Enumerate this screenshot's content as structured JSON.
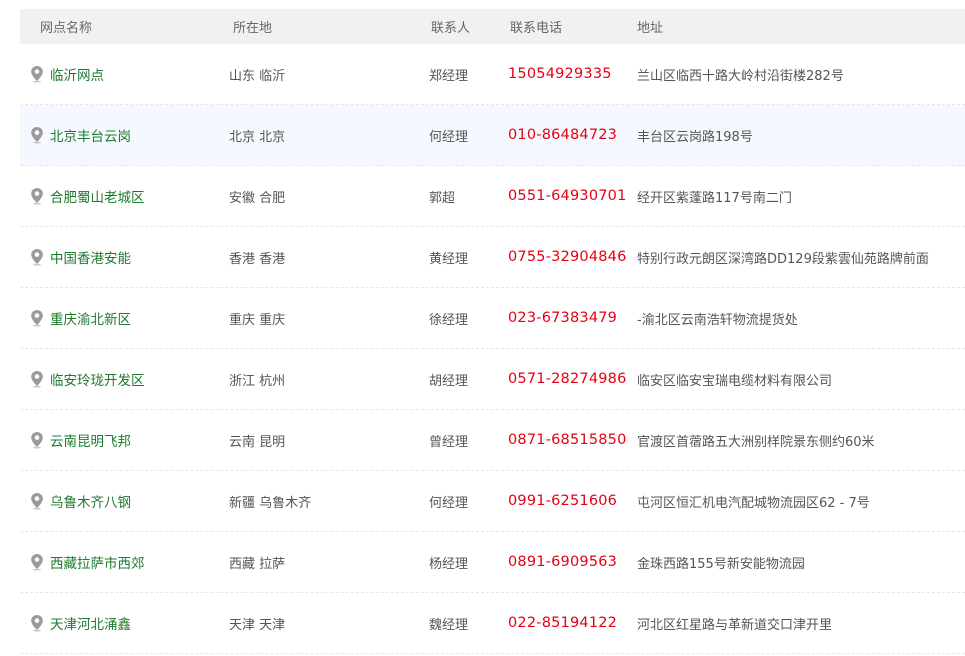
{
  "headers": {
    "name": "网点名称",
    "location": "所在地",
    "contact": "联系人",
    "phone": "联系电话",
    "address": "地址"
  },
  "rows": [
    {
      "name": "临沂网点",
      "location": "山东 临沂",
      "contact": "郑经理",
      "phone": "15054929335",
      "address": "兰山区临西十路大岭村沿街楼282号"
    },
    {
      "name": "北京丰台云岗",
      "location": "北京 北京",
      "contact": "何经理",
      "phone": "010-86484723",
      "address": "丰台区云岗路198号"
    },
    {
      "name": "合肥蜀山老城区",
      "location": "安徽 合肥",
      "contact": "郭超",
      "phone": "0551-64930701",
      "address": "经开区紫蓬路117号南二门"
    },
    {
      "name": "中国香港安能",
      "location": "香港 香港",
      "contact": "黄经理",
      "phone": "0755-32904846",
      "address": "特别行政元朗区深湾路DD129段紫雲仙苑路牌前面"
    },
    {
      "name": "重庆渝北新区",
      "location": "重庆 重庆",
      "contact": "徐经理",
      "phone": "023-67383479",
      "address": "-渝北区云南浩轩物流提货处"
    },
    {
      "name": "临安玲珑开发区",
      "location": "浙江 杭州",
      "contact": "胡经理",
      "phone": "0571-28274986",
      "address": "临安区临安宝瑞电缆材料有限公司"
    },
    {
      "name": "云南昆明飞邦",
      "location": "云南 昆明",
      "contact": "曾经理",
      "phone": "0871-68515850",
      "address": "官渡区首蓿路五大洲别样院景东侧约60米"
    },
    {
      "name": "乌鲁木齐八钢",
      "location": "新疆 乌鲁木齐",
      "contact": "何经理",
      "phone": "0991-6251606",
      "address": "屯河区恒汇机电汽配城物流园区62 - 7号"
    },
    {
      "name": "西藏拉萨市西郊",
      "location": "西藏 拉萨",
      "contact": "杨经理",
      "phone": "0891-6909563",
      "address": "金珠西路155号新安能物流园"
    },
    {
      "name": "天津河北涌鑫",
      "location": "天津 天津",
      "contact": "魏经理",
      "phone": "022-85194122",
      "address": "河北区红星路与革新道交口津开里"
    }
  ],
  "colors": {
    "name_green": "#1e7a2e",
    "phone_red": "#e60012",
    "header_bg": "#f1f1f1",
    "highlight_row_bg": "#f5f9ff"
  },
  "icons": {
    "row_icon": "location-pin-icon"
  }
}
